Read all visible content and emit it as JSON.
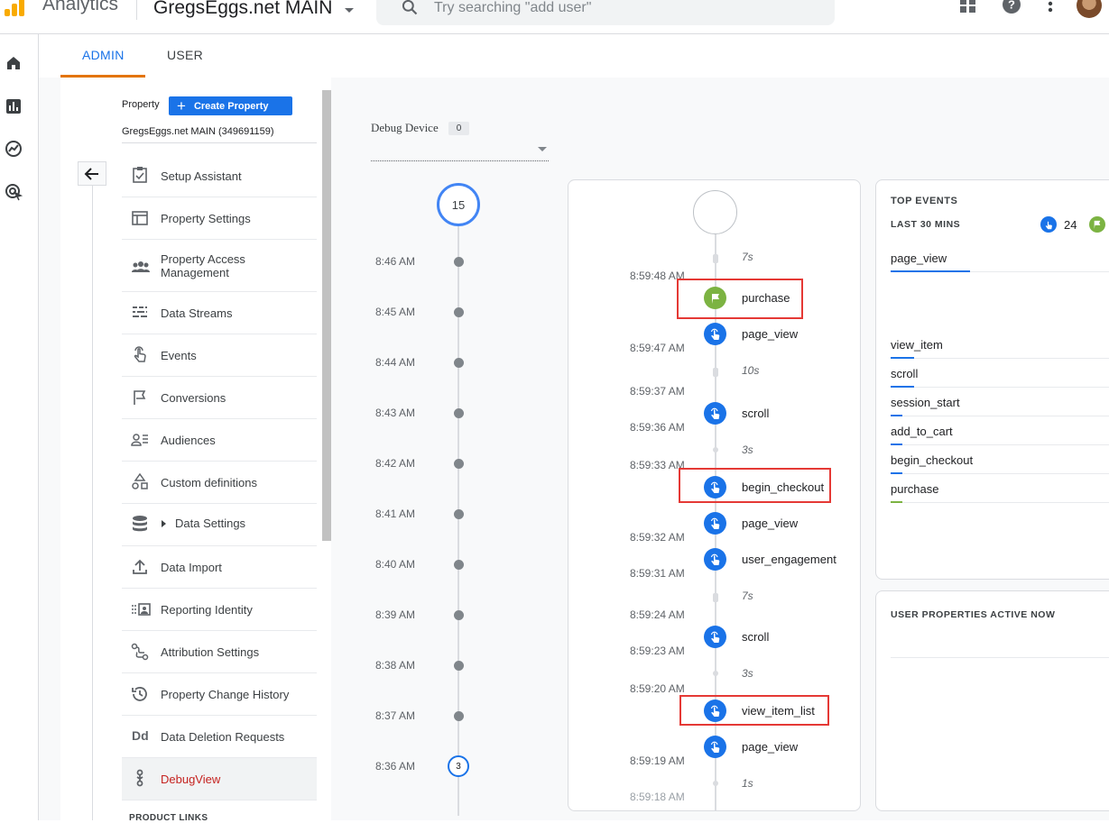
{
  "header": {
    "app_name": "Analytics",
    "property_selector": "GregsEggs.net MAIN",
    "search_placeholder": "Try searching \"add user\"",
    "icons": [
      "apps-grid-icon",
      "help-icon",
      "more-vert-icon",
      "avatar"
    ]
  },
  "left_nav": {
    "icons": [
      "home-icon",
      "reports-icon",
      "explore-icon",
      "advertising-icon"
    ]
  },
  "tabs": {
    "admin": "ADMIN",
    "user": "USER"
  },
  "admin": {
    "property_label": "Property",
    "create_property": "Create Property",
    "property_id": "GregsEggs.net MAIN (349691159)",
    "menu": [
      {
        "label": "Setup Assistant",
        "icon": "checklist-icon"
      },
      {
        "label": "Property Settings",
        "icon": "property-settings-icon"
      },
      {
        "label": "Property Access Management",
        "icon": "people-icon"
      },
      {
        "label": "Data Streams",
        "icon": "data-streams-icon"
      },
      {
        "label": "Events",
        "icon": "touch-icon"
      },
      {
        "label": "Conversions",
        "icon": "flag-icon"
      },
      {
        "label": "Audiences",
        "icon": "audiences-icon"
      },
      {
        "label": "Custom definitions",
        "icon": "shapes-icon"
      },
      {
        "label": "Data Settings",
        "icon": "database-icon"
      },
      {
        "label": "Data Import",
        "icon": "upload-icon"
      },
      {
        "label": "Reporting Identity",
        "icon": "identity-icon"
      },
      {
        "label": "Attribution Settings",
        "icon": "attribution-icon"
      },
      {
        "label": "Property Change History",
        "icon": "history-icon"
      },
      {
        "label": "Data Deletion Requests",
        "icon": "dd-icon"
      },
      {
        "label": "DebugView",
        "icon": "debug-icon"
      }
    ],
    "product_links": "PRODUCT LINKS"
  },
  "debug": {
    "device_label": "Debug Device",
    "device_count": "0",
    "minute_circle_top": "15",
    "minutes": [
      {
        "time": "8:46 AM"
      },
      {
        "time": "8:45 AM"
      },
      {
        "time": "8:44 AM"
      },
      {
        "time": "8:43 AM"
      },
      {
        "time": "8:42 AM"
      },
      {
        "time": "8:41 AM"
      },
      {
        "time": "8:40 AM"
      },
      {
        "time": "8:39 AM"
      },
      {
        "time": "8:38 AM"
      },
      {
        "time": "8:37 AM"
      },
      {
        "time": "8:36 AM",
        "count": "3"
      }
    ],
    "seconds": {
      "times": [
        "8:59:48 AM",
        "8:59:47 AM",
        "8:59:37 AM",
        "8:59:36 AM",
        "8:59:33 AM",
        "8:59:32 AM",
        "8:59:31 AM",
        "8:59:24 AM",
        "8:59:23 AM",
        "8:59:20 AM",
        "8:59:19 AM",
        "8:59:18 AM"
      ],
      "gaps": [
        "7s",
        "10s",
        "3s",
        "7s",
        "3s",
        "1s"
      ],
      "events": [
        {
          "name": "purchase",
          "type": "conversion",
          "highlighted": true
        },
        {
          "name": "page_view",
          "type": "event",
          "highlighted": false
        },
        {
          "name": "scroll",
          "type": "event",
          "highlighted": false
        },
        {
          "name": "begin_checkout",
          "type": "event",
          "highlighted": true
        },
        {
          "name": "page_view",
          "type": "event",
          "highlighted": false
        },
        {
          "name": "user_engagement",
          "type": "event",
          "highlighted": false
        },
        {
          "name": "scroll",
          "type": "event",
          "highlighted": false
        },
        {
          "name": "view_item_list",
          "type": "event",
          "highlighted": true
        },
        {
          "name": "page_view",
          "type": "event",
          "highlighted": false
        }
      ]
    },
    "top_events": {
      "title": "TOP EVENTS",
      "period": "LAST 30 MINS",
      "event_count": "24",
      "items": [
        {
          "name": "page_view",
          "color": "#1a73e8"
        },
        {
          "name": "view_item",
          "color": "#1a73e8"
        },
        {
          "name": "scroll",
          "color": "#1a73e8"
        },
        {
          "name": "session_start",
          "color": "#1a73e8"
        },
        {
          "name": "add_to_cart",
          "color": "#1a73e8"
        },
        {
          "name": "begin_checkout",
          "color": "#1a73e8"
        },
        {
          "name": "purchase",
          "color": "#7cb342"
        }
      ]
    },
    "user_properties": {
      "title": "USER PROPERTIES ACTIVE NOW"
    }
  },
  "colors": {
    "accent": "#1a73e8",
    "admin_tab_underline": "#e37400",
    "conversion": "#7cb342",
    "highlight": "#e53935",
    "active_menu_text": "#c5221f"
  }
}
